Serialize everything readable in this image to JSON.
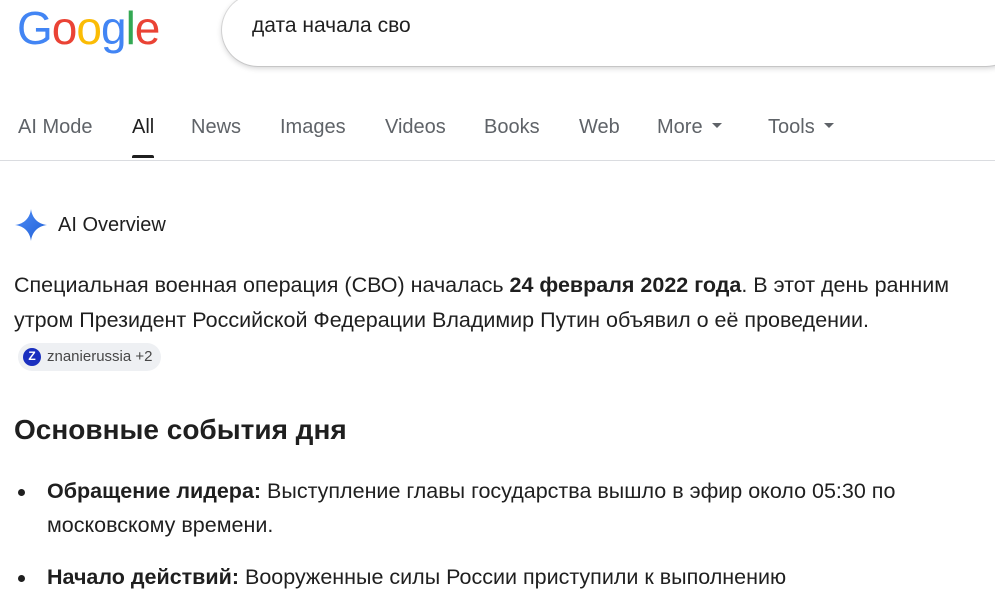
{
  "logo": {
    "letters": [
      "G",
      "o",
      "o",
      "g",
      "l",
      "e"
    ],
    "colors": [
      "#4285F4",
      "#EA4335",
      "#FBBC05",
      "#4285F4",
      "#34A853",
      "#EA4335"
    ]
  },
  "search": {
    "query": "дата начала сво"
  },
  "tabs": [
    {
      "label": "AI Mode"
    },
    {
      "label": "All",
      "active": true
    },
    {
      "label": "News"
    },
    {
      "label": "Images"
    },
    {
      "label": "Videos"
    },
    {
      "label": "Books"
    },
    {
      "label": "Web"
    },
    {
      "label": "More",
      "dropdown": true
    },
    {
      "label": "Tools",
      "dropdown": true
    }
  ],
  "ai_overview": {
    "icon": "sparkle-icon",
    "label": "AI Overview",
    "intro_pre": "Специальная военная операция (СВО) началась ",
    "intro_bold": "24 февраля 2022 года",
    "intro_post": ". В этот день ранним утром Президент Российской Федерации Владимир Путин объявил о её проведении.",
    "source_chip": {
      "icon": "znanie-icon",
      "text": "znanierussia +2"
    }
  },
  "section": {
    "heading": "Основные события дня",
    "items": [
      {
        "bold": "Обращение лидера:",
        "text": " Выступление главы государства вышло в эфир около 05:30 по московскому времени."
      },
      {
        "bold": "Начало действий:",
        "text": " Вооруженные силы России приступили к выполнению"
      }
    ]
  }
}
